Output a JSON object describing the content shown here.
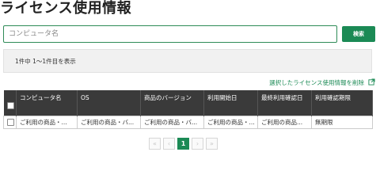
{
  "page": {
    "title": "ライセンス使用情報"
  },
  "search": {
    "placeholder": "コンピュータ名",
    "value": "",
    "button_label": "検索"
  },
  "result": {
    "summary": "1件中 1～1件目を表示"
  },
  "actions": {
    "delete_selected_label": "選択したライセンス使用情報を削除",
    "delete_icon": "external-link-icon"
  },
  "table": {
    "columns": [
      "コンピュータ名",
      "OS",
      "商品のバージョン",
      "利用開始日",
      "最終利用確認日",
      "利用確認期限"
    ],
    "rows": [
      {
        "checked": false,
        "cells": [
          "ご利用の商品・...",
          "ご利用の商品・バ...",
          "ご利用の商品・バ...",
          "ご利用の商品・...",
          "ご利用の商品...",
          "無期限"
        ]
      }
    ]
  },
  "pagination": {
    "first": "«",
    "prev": "‹",
    "current": "1",
    "next": "›",
    "last": "»"
  },
  "colors": {
    "accent": "#1b8a55",
    "header_bg": "#3a3a3a"
  }
}
